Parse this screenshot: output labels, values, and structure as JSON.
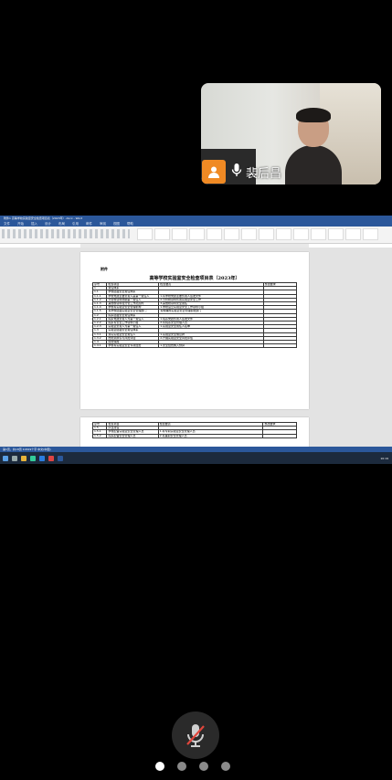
{
  "participant": {
    "name": "裴后昌"
  },
  "word": {
    "title_bar": "附件1 高等学校实验室安全检查项目表（2023年）.docx - Word",
    "menu": [
      "文件",
      "开始",
      "插入",
      "设计",
      "布局",
      "引用",
      "邮件",
      "审阅",
      "视图",
      "帮助"
    ],
    "attachment_label": "附件",
    "doc_title": "高等学校实验室安全检查项目表（2023年）",
    "table_headers": [
      "序号",
      "检查项目",
      "检查要点",
      "整改要求"
    ],
    "rows": [
      [
        "1",
        "责任体系",
        "",
        ""
      ],
      [
        "1.1",
        "学校层面安全责任体系",
        "",
        ""
      ],
      [
        "1.1.1",
        "学校党政主要负责人是第一责任人",
        "1.有学校党政主要负责人签发文件",
        ""
      ],
      [
        "1.1.2",
        "分管校领导协助第一责任人",
        "2.分管校领导负责实验室安全工作",
        ""
      ],
      [
        "1.1.3",
        "其他校领导在分管工作范围内",
        "3.其他校领导安全责任",
        ""
      ],
      [
        "1.1.4",
        "学校有实验室安全管理机构",
        "1.学校设立实验室安全工作领导小组",
        ""
      ],
      [
        "1.1.5",
        "有学校层面实验室安全管理部门",
        "有明确的实验室安全管理职能部门",
        ""
      ],
      [
        "1.2",
        "院系层面安全责任体系",
        "",
        ""
      ],
      [
        "1.2.1",
        "院系党政负责人为第一责任人",
        "1.院系党政负责人签发文件",
        ""
      ],
      [
        "1.2.2",
        "院系有安全工作领导小组",
        "2.有院系安全管理人员",
        ""
      ],
      [
        "1.2.3",
        "实验室负责人为第一责任人",
        "1.实验室安全责任人名单",
        ""
      ],
      [
        "1.3",
        "实验室层面安全责任体系",
        "",
        ""
      ],
      [
        "1.3.1",
        "落实实验室安全责任人",
        "1.实验室安全信息牌",
        ""
      ],
      [
        "1.3.2",
        "危险源辨识与风险评估",
        "2.开展实验室安全风险评估",
        ""
      ],
      [
        "1.4",
        "经费保障",
        "",
        ""
      ],
      [
        "1.4.1",
        "学校有实验室安全专项经费",
        "1.安全经费纳入预算",
        ""
      ]
    ],
    "page2_rows": [
      [
        "1.5",
        "队伍建设",
        "",
        ""
      ],
      [
        "1.5.1",
        "学校配备实验室安全管理人员",
        "1.有专职实验室安全管理人员",
        ""
      ],
      [
        "1.5.2",
        "院系配备安全管理人员",
        "2.有兼职安全管理人员",
        ""
      ]
    ],
    "status": "第1页，共18页  10329个字  中文(中国)",
    "clock": "10:19"
  },
  "pager": {
    "total": 4,
    "active": 0
  }
}
